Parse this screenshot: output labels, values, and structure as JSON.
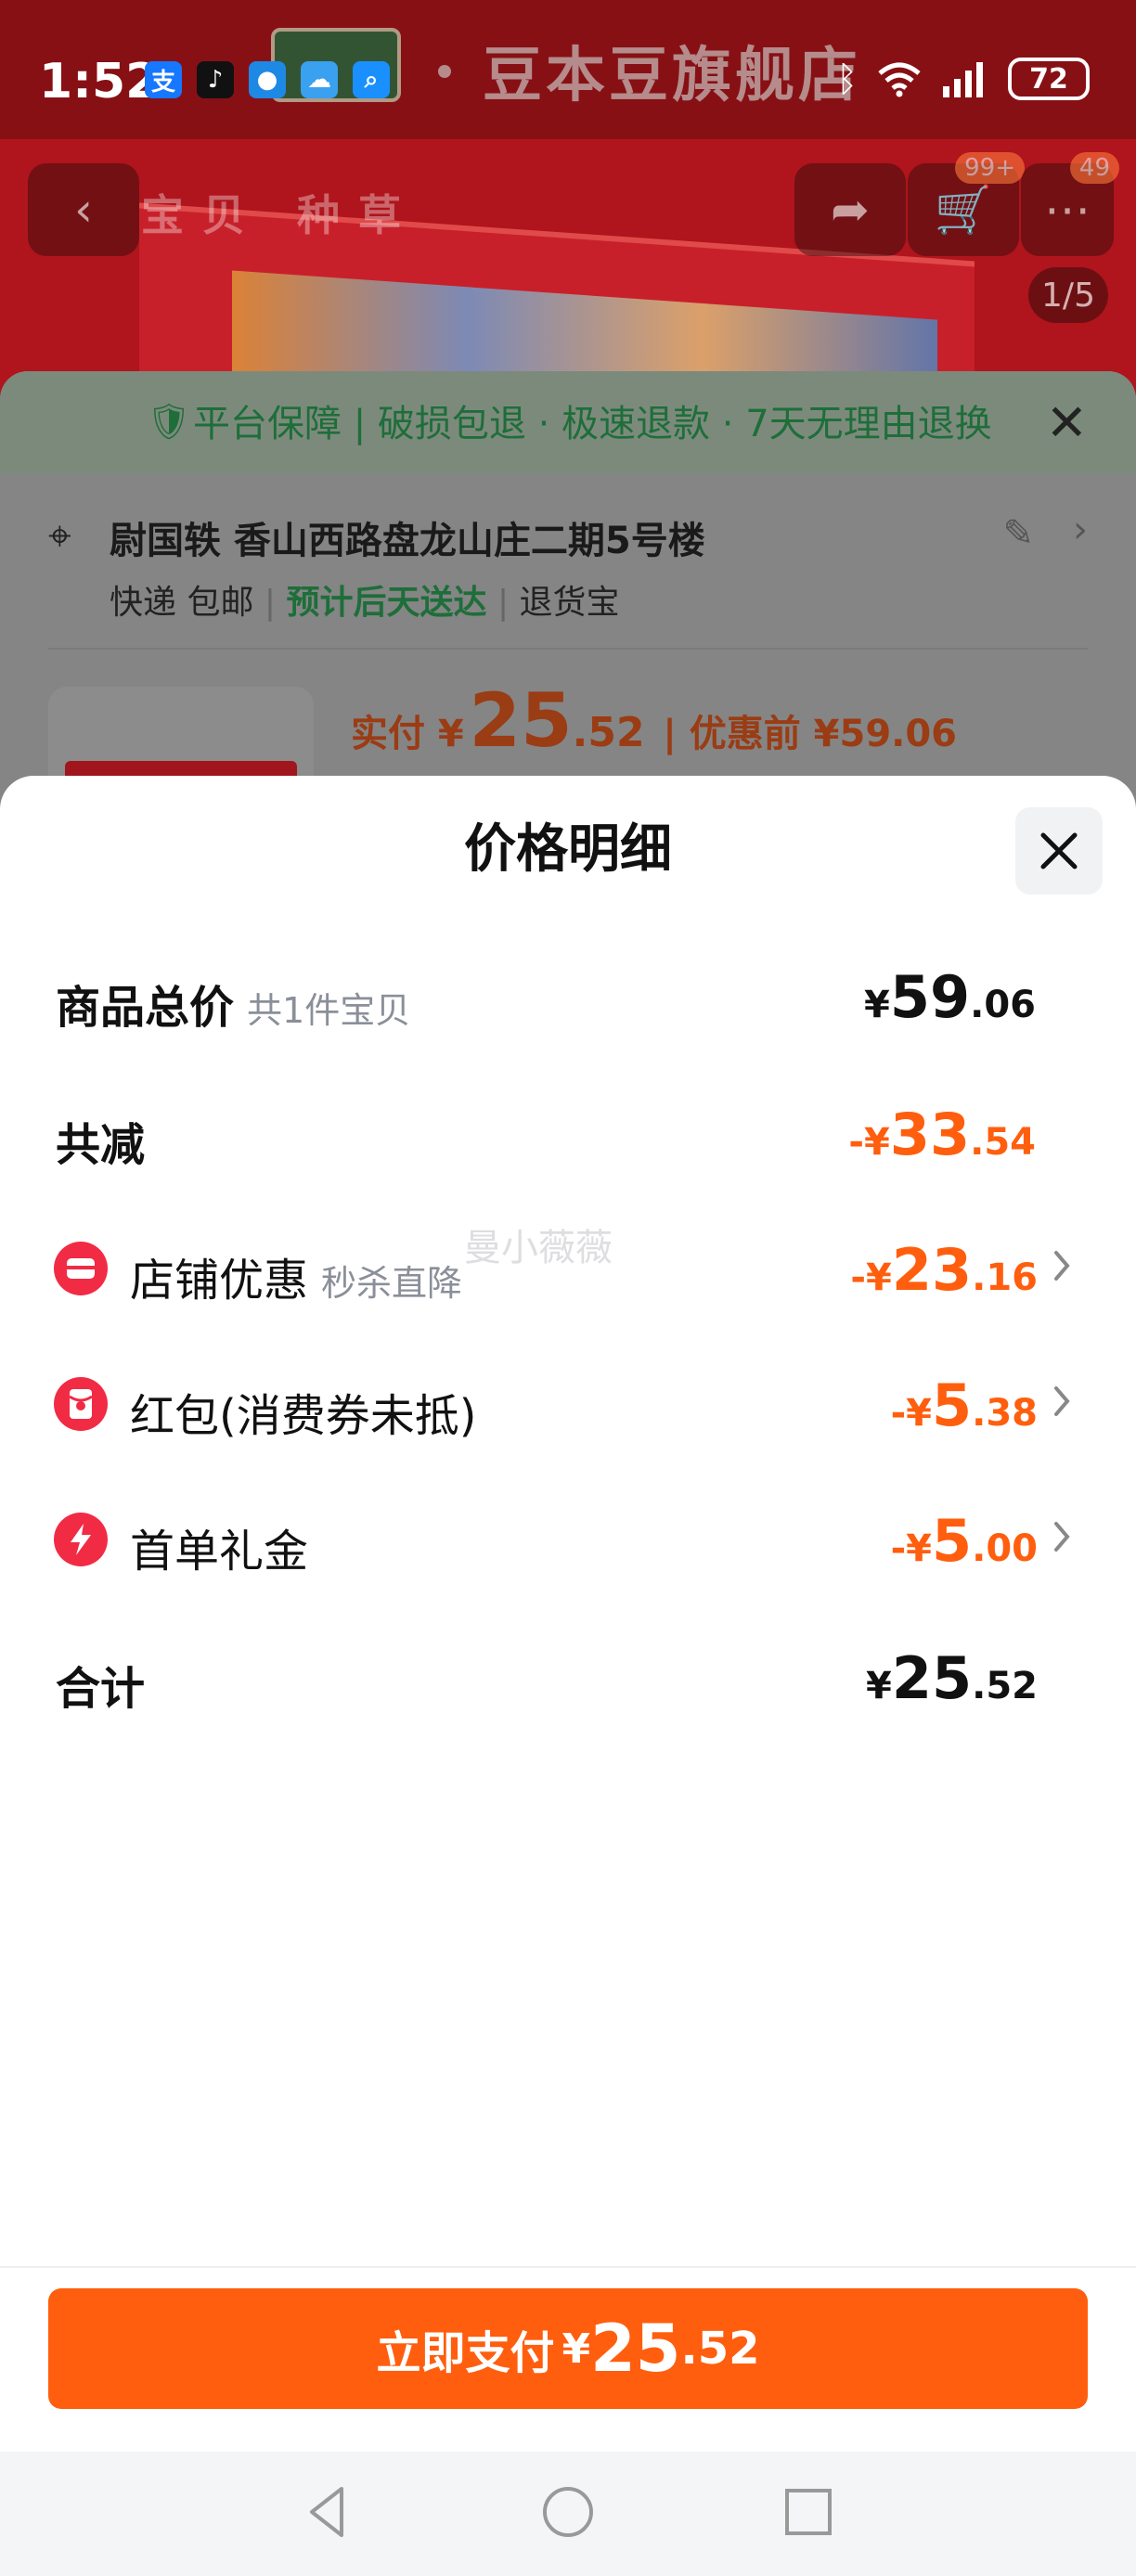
{
  "status_bar": {
    "time": "1:52",
    "apps": [
      "alipay-icon",
      "tiktok-icon",
      "message-icon",
      "weather-icon",
      "search-app-icon"
    ],
    "battery": "72"
  },
  "background": {
    "shop_name": "豆本豆旗舰店",
    "nav_tabs": "宝贝 种草",
    "cart_badge": "99+",
    "message_badge": "49",
    "image_counter": "1/5",
    "guarantee_text": "平台保障 | 破损包退 · 极速退款 · 7天无理由退换",
    "address": "尉国轶 香山西路盘龙山庄二期5号楼",
    "delivery_express": "快递 包邮",
    "delivery_eta": "预计后天送达",
    "delivery_return": "退货宝",
    "paid_label": "实付 ¥",
    "paid_int": "25",
    "paid_dec": ".52",
    "before_discount": "| 优惠前 ¥59.06"
  },
  "modal": {
    "title": "价格明细",
    "watermark": "曼小薇薇",
    "rows": {
      "total": {
        "label": "商品总价",
        "sub": "共1件宝贝",
        "currency": "¥",
        "int": "59",
        "dec": ".06"
      },
      "reduced": {
        "label": "共减",
        "currency": "-¥",
        "int": "33",
        "dec": ".54"
      },
      "shop": {
        "label": "店铺优惠",
        "sub": "秒杀直降",
        "currency": "-¥",
        "int": "23",
        "dec": ".16",
        "icon": "shop-coupon-icon"
      },
      "redpacket": {
        "label": "红包(消费券未抵)",
        "currency": "-¥",
        "int": "5",
        "dec": ".38",
        "icon": "red-packet-icon"
      },
      "firstorder": {
        "label": "首单礼金",
        "currency": "-¥",
        "int": "5",
        "dec": ".00",
        "icon": "lightning-icon"
      },
      "sum": {
        "label": "合计",
        "currency": "¥",
        "int": "25",
        "dec": ".52"
      }
    },
    "pay_button": {
      "label": "立即支付",
      "currency": "¥",
      "int": "25",
      "dec": ".52"
    }
  },
  "colors": {
    "accent": "#ff5e0e",
    "icon_red": "#f22b45",
    "text_dark": "#111111",
    "text_sub": "#8a8f99"
  }
}
